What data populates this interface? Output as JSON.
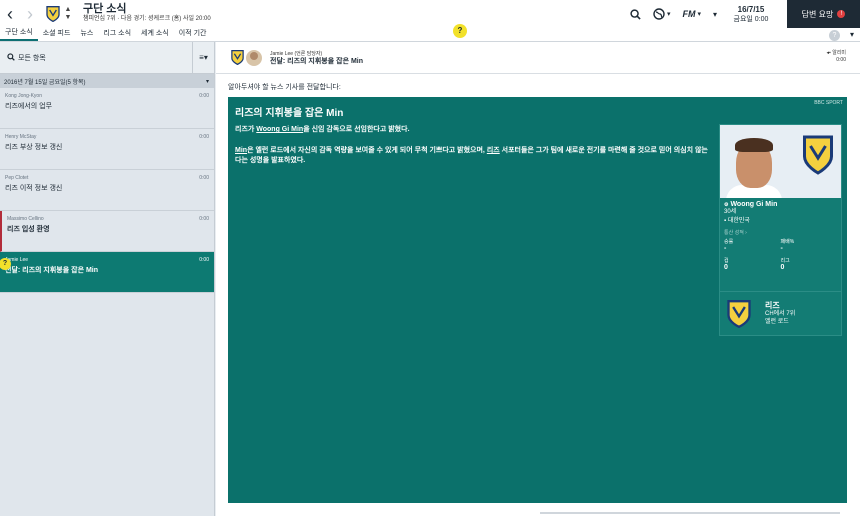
{
  "header": {
    "title": "구단 소식",
    "subtitle": "챔피언십 7위 · 다음 경기: 셩케르크 (홈) 사일 20:00",
    "date": "16/7/15",
    "date_sub": "금요일 0:00",
    "continue_label": "답변 요망",
    "continue_badge": "!",
    "help_bubble": "?"
  },
  "tabs": [
    {
      "label": "구단 소식",
      "active": true
    },
    {
      "label": "소셜 피드",
      "active": false
    },
    {
      "label": "뉴스",
      "active": false
    },
    {
      "label": "리그 소식",
      "active": false
    },
    {
      "label": "세계 소식",
      "active": false
    },
    {
      "label": "이적 기간",
      "active": false
    }
  ],
  "sidebar": {
    "filter_label": "모든 항목",
    "view_label": "≡",
    "group_label": "2016년 7월 15일 금요일(5 항목)",
    "items": [
      {
        "from": "Kong Jong-Kyon",
        "time": "0:00",
        "subject": "리즈에서의 업무"
      },
      {
        "from": "Henry McStay",
        "time": "0:00",
        "subject": "리즈 부상 정보 갱신"
      },
      {
        "from": "Pep Clotet",
        "time": "0:00",
        "subject": "리즈 이적 정보 갱신"
      },
      {
        "from": "Massimo Cellino",
        "time": "0:00",
        "subject": "리즈 입성 환영"
      },
      {
        "from": "Jamie Lee",
        "time": "0:00",
        "subject": "전달: 리즈의 지휘봉을 잡은 Min"
      }
    ],
    "selected_q": "?"
  },
  "message": {
    "sender": "Jamie Lee",
    "sender_role": "(언론 담당자)",
    "subject": "전달: 리즈의 지휘봉을 잡은 Min",
    "ignore_label": "알리미",
    "ignore_label2": "0:00",
    "intro": "알아두셔야 할 뉴스 기사를 전달합니다:",
    "source": "BBC SPORT",
    "headline": "리즈의 지휘봉을 잡은 Min",
    "p1_a": "리즈가 ",
    "p1_link": "Woong Gi Min",
    "p1_b": "을 신임 감독으로 선임한다고 밝혔다.",
    "p2_link": "Min",
    "p2_a": "은 엘런 로드에서 자신의 감독 역량을 보여줄 수 있게 되어 무척 기쁘다고 밝혔으며, ",
    "p2_link2": "리즈",
    "p2_b": " 서포터들은 그가 팀에 새로운 전기를 마련해 줄 것으로 믿어 의심치 않는다는 성명을 발표하였다."
  },
  "manager_card": {
    "name": "Woong Gi Min",
    "age": "30세",
    "nation": "대한민국",
    "career_label": "통산 성적 ›",
    "stats": [
      {
        "label": "승률",
        "value": "-"
      },
      {
        "label": "패배%",
        "value": "-"
      },
      {
        "label": "컵",
        "value": "0"
      },
      {
        "label": "리그",
        "value": "0"
      }
    ],
    "club_name": "리즈",
    "club_rank": "CH에서 7위",
    "club_ground": "엘런 로드"
  },
  "colors": {
    "teal": "#0b716b",
    "selected": "#0d7a72",
    "dark": "#1e2a35",
    "yellow": "#f2e12a"
  }
}
